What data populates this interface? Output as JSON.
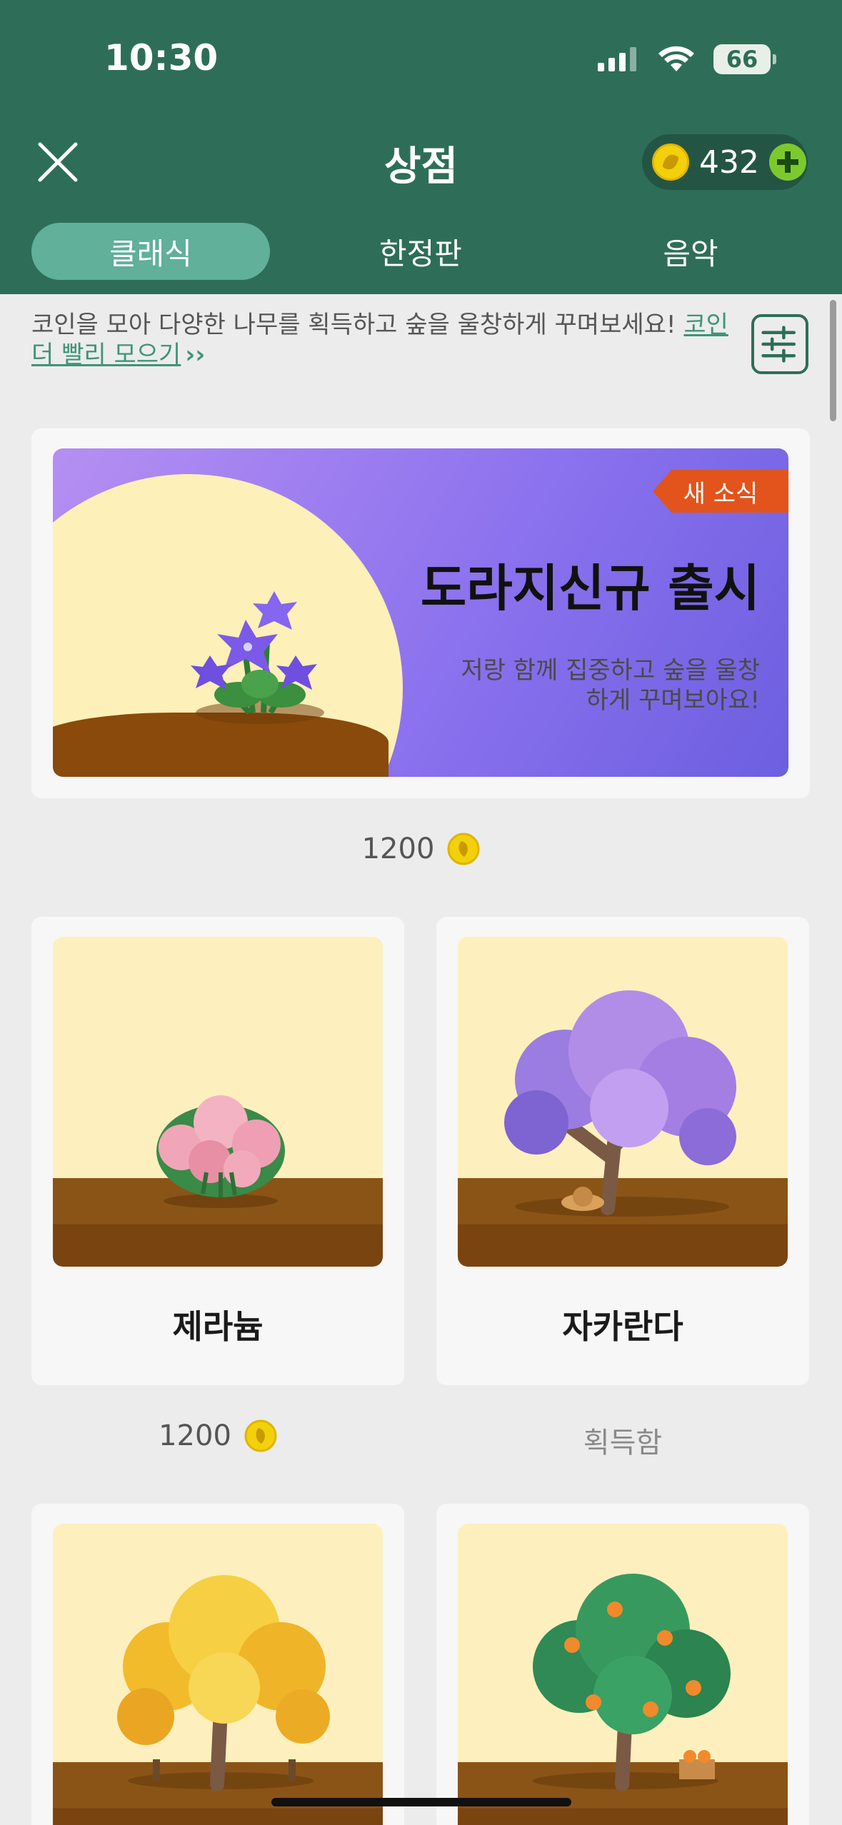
{
  "status": {
    "time": "10:30",
    "battery": "66"
  },
  "header": {
    "title": "상점",
    "coins": "432"
  },
  "tabs": [
    {
      "label": "클래식",
      "active": true
    },
    {
      "label": "한정판",
      "active": false
    },
    {
      "label": "음악",
      "active": false
    }
  ],
  "info": {
    "text": "코인을 모아 다양한 나무를 획득하고 숲을 울창하게 꾸며보세요!",
    "link": "코인 더 빨리 모으기"
  },
  "banner": {
    "badge": "새 소식",
    "title": "도라지신규 출시",
    "subtitle": "저랑 함께 집중하고 숲을 울창하게 꾸며보아요!",
    "price": "1200"
  },
  "items": [
    {
      "name": "제라늄",
      "price": "1200",
      "owned_label": ""
    },
    {
      "name": "자카란다",
      "price": "",
      "owned_label": "획득함"
    }
  ],
  "colors": {
    "header": "#2e6e58",
    "tab_active": "#61b099",
    "accent_link": "#3f9479",
    "coin": "#f2d10b",
    "badge": "#e2541c"
  }
}
